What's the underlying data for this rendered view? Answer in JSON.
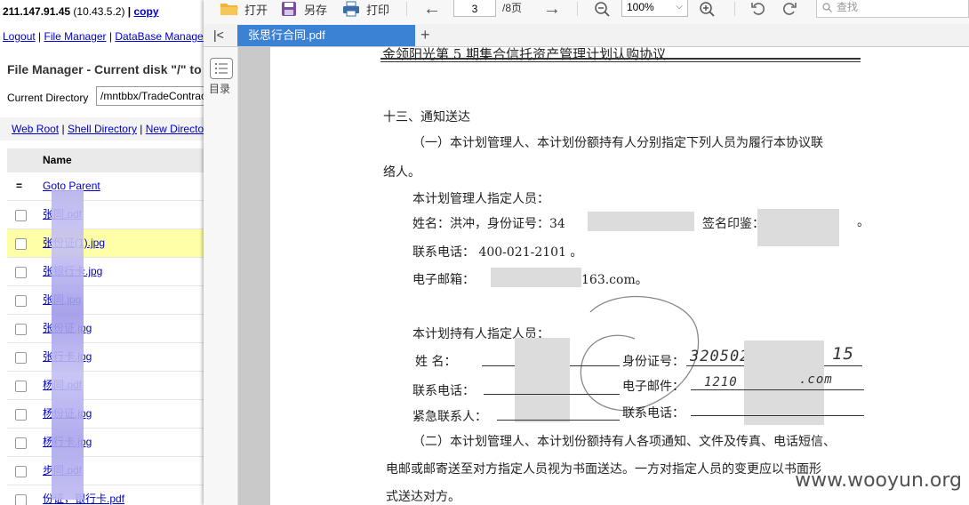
{
  "file_manager": {
    "ip": "211.147.91.45",
    "ip_paren": "(10.43.5.2)",
    "copy_label": "copy",
    "nav": [
      "Logout",
      "File Manager",
      "DataBase Manage"
    ],
    "title": "File Manager - Current disk \"/\" to",
    "current_dir_label": "Current Directory",
    "current_dir_value": "/mntbbx/TradeContrac",
    "links": [
      "Web Root",
      "Shell Directory",
      "New Directo"
    ],
    "column_name": "Name",
    "goto_parent": "Goto Parent",
    "files": [
      {
        "name": "张同.pdf",
        "highlight": false
      },
      {
        "name": "张份证(1).jpg",
        "highlight": true
      },
      {
        "name": "张银行卡.jpg",
        "highlight": false
      },
      {
        "name": "张同.jpg",
        "highlight": false
      },
      {
        "name": "张份证.jpg",
        "highlight": false
      },
      {
        "name": "张行卡.jpg",
        "highlight": false
      },
      {
        "name": "杨同.pdf",
        "highlight": false
      },
      {
        "name": "杨份证.jpg",
        "highlight": false
      },
      {
        "name": "杨行卡.jpg",
        "highlight": false
      },
      {
        "name": "步同.pdf",
        "highlight": false
      },
      {
        "name": "份证，银行卡.pdf",
        "highlight": false
      }
    ]
  },
  "viewer": {
    "toolbar": {
      "open": "打开",
      "save_as": "另存",
      "print": "打印",
      "page_current": "3",
      "page_total": "/8页",
      "zoom": "100%",
      "search_placeholder": "查找"
    },
    "tab_title": "张思行合同.pdf",
    "toc_label": "目录",
    "document": {
      "header": "金领阳光第 5 期集合信托资产管理计划认购协议",
      "section": "十三、通知送达",
      "para1_a": "（一）本计划管理人、本计划份额持有人分别指定下列人员为履行本协议联",
      "para1_b": "络人。",
      "manager_heading": "本计划管理人指定人员：",
      "manager_name_line": "姓名：洪冲，身份证号：34",
      "manager_seal": "签名印鉴：",
      "manager_phone": "联系电话：  400-021-2101 。",
      "manager_email_a": "电子邮箱：",
      "manager_email_b": "163.com。",
      "holder_heading": "本计划持有人指定人员：",
      "holder_name_label": "姓    名：",
      "holder_id_label": "身份证号：",
      "holder_id_value": "320502",
      "holder_id_tail": "15",
      "holder_phone_label": "联系电话：",
      "holder_email_label": "电子邮件：",
      "holder_email_value": "1210",
      "holder_email_tail": ".com",
      "emergency_label": "紧急联系人：",
      "emergency_phone_label": "联系电话：",
      "para2_a": "（二）本计划管理人、本计划份额持有人各项通知、文件及传真、电话短信、",
      "para2_b": "电邮或邮寄送至对方指定人员视为书面送达。一方对指定人员的变更应以书面形",
      "para2_c": "式送达对方。"
    },
    "watermark": "www.wooyun.org"
  }
}
